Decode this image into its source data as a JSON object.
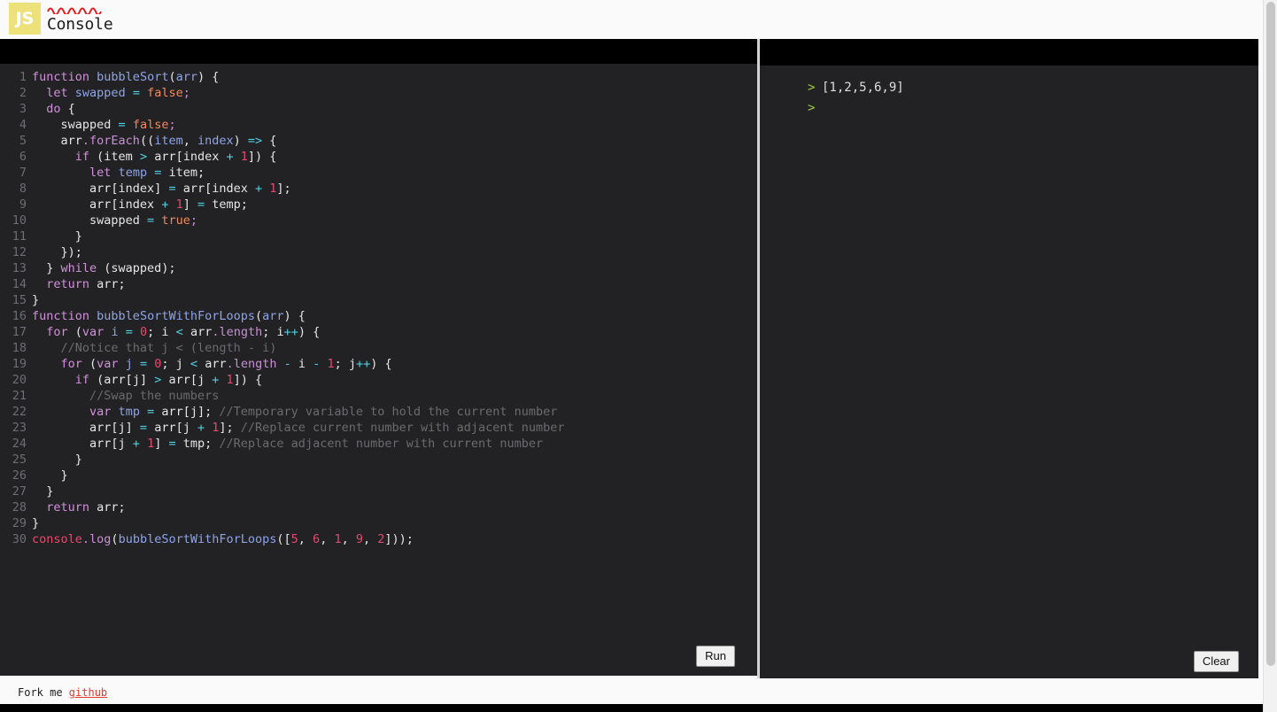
{
  "header": {
    "logo_text": "JS",
    "title": "Console",
    "squiggle_color": "#e02020",
    "logo_bg": "#ede17a"
  },
  "editor": {
    "run_label": "Run",
    "line_count": 30,
    "lines": [
      {
        "n": "1",
        "tokens": [
          {
            "t": "function",
            "c": "kw"
          },
          {
            "t": " ",
            "c": "plain"
          },
          {
            "t": "bubbleSort",
            "c": "fn"
          },
          {
            "t": "(",
            "c": "plain"
          },
          {
            "t": "arr",
            "c": "fn"
          },
          {
            "t": ") {",
            "c": "plain"
          }
        ]
      },
      {
        "n": "2",
        "tokens": [
          {
            "t": "  ",
            "c": "plain"
          },
          {
            "t": "let",
            "c": "kw"
          },
          {
            "t": " ",
            "c": "plain"
          },
          {
            "t": "swapped",
            "c": "fn"
          },
          {
            "t": " ",
            "c": "plain"
          },
          {
            "t": "=",
            "c": "op"
          },
          {
            "t": " ",
            "c": "plain"
          },
          {
            "t": "false",
            "c": "bool"
          },
          {
            "t": ";",
            "c": "punc"
          }
        ]
      },
      {
        "n": "3",
        "tokens": [
          {
            "t": "  ",
            "c": "plain"
          },
          {
            "t": "do",
            "c": "kw"
          },
          {
            "t": " {",
            "c": "plain"
          }
        ]
      },
      {
        "n": "4",
        "tokens": [
          {
            "t": "    swapped ",
            "c": "plain"
          },
          {
            "t": "=",
            "c": "op"
          },
          {
            "t": " ",
            "c": "plain"
          },
          {
            "t": "false",
            "c": "bool"
          },
          {
            "t": ";",
            "c": "punc"
          }
        ]
      },
      {
        "n": "5",
        "tokens": [
          {
            "t": "    arr",
            "c": "plain"
          },
          {
            "t": ".forEach",
            "c": "prop"
          },
          {
            "t": "((",
            "c": "plain"
          },
          {
            "t": "item",
            "c": "fn"
          },
          {
            "t": ", ",
            "c": "plain"
          },
          {
            "t": "index",
            "c": "fn"
          },
          {
            "t": ") ",
            "c": "plain"
          },
          {
            "t": "=>",
            "c": "op"
          },
          {
            "t": " {",
            "c": "plain"
          }
        ]
      },
      {
        "n": "6",
        "tokens": [
          {
            "t": "      ",
            "c": "plain"
          },
          {
            "t": "if",
            "c": "kw"
          },
          {
            "t": " (item ",
            "c": "plain"
          },
          {
            "t": ">",
            "c": "op"
          },
          {
            "t": " arr[index ",
            "c": "plain"
          },
          {
            "t": "+",
            "c": "op"
          },
          {
            "t": " ",
            "c": "plain"
          },
          {
            "t": "1",
            "c": "num"
          },
          {
            "t": "]) {",
            "c": "plain"
          }
        ]
      },
      {
        "n": "7",
        "tokens": [
          {
            "t": "        ",
            "c": "plain"
          },
          {
            "t": "let",
            "c": "kw"
          },
          {
            "t": " ",
            "c": "plain"
          },
          {
            "t": "temp",
            "c": "fn"
          },
          {
            "t": " ",
            "c": "plain"
          },
          {
            "t": "=",
            "c": "op"
          },
          {
            "t": " item;",
            "c": "plain"
          }
        ]
      },
      {
        "n": "8",
        "tokens": [
          {
            "t": "        arr[index] ",
            "c": "plain"
          },
          {
            "t": "=",
            "c": "op"
          },
          {
            "t": " arr[index ",
            "c": "plain"
          },
          {
            "t": "+",
            "c": "op"
          },
          {
            "t": " ",
            "c": "plain"
          },
          {
            "t": "1",
            "c": "num"
          },
          {
            "t": "];",
            "c": "plain"
          }
        ]
      },
      {
        "n": "9",
        "tokens": [
          {
            "t": "        arr[index ",
            "c": "plain"
          },
          {
            "t": "+",
            "c": "op"
          },
          {
            "t": " ",
            "c": "plain"
          },
          {
            "t": "1",
            "c": "num"
          },
          {
            "t": "] ",
            "c": "plain"
          },
          {
            "t": "=",
            "c": "op"
          },
          {
            "t": " temp;",
            "c": "plain"
          }
        ]
      },
      {
        "n": "10",
        "tokens": [
          {
            "t": "        swapped ",
            "c": "plain"
          },
          {
            "t": "=",
            "c": "op"
          },
          {
            "t": " ",
            "c": "plain"
          },
          {
            "t": "true",
            "c": "bool"
          },
          {
            "t": ";",
            "c": "punc"
          }
        ]
      },
      {
        "n": "11",
        "tokens": [
          {
            "t": "      }",
            "c": "plain"
          }
        ]
      },
      {
        "n": "12",
        "tokens": [
          {
            "t": "    });",
            "c": "plain"
          }
        ]
      },
      {
        "n": "13",
        "tokens": [
          {
            "t": "  } ",
            "c": "plain"
          },
          {
            "t": "while",
            "c": "kw"
          },
          {
            "t": " (swapped);",
            "c": "plain"
          }
        ]
      },
      {
        "n": "14",
        "tokens": [
          {
            "t": "  ",
            "c": "plain"
          },
          {
            "t": "return",
            "c": "kw"
          },
          {
            "t": " arr;",
            "c": "plain"
          }
        ]
      },
      {
        "n": "15",
        "tokens": [
          {
            "t": "}",
            "c": "plain"
          }
        ]
      },
      {
        "n": "16",
        "tokens": [
          {
            "t": "function",
            "c": "kw"
          },
          {
            "t": " ",
            "c": "plain"
          },
          {
            "t": "bubbleSortWithForLoops",
            "c": "fn"
          },
          {
            "t": "(",
            "c": "plain"
          },
          {
            "t": "arr",
            "c": "fn"
          },
          {
            "t": ") {",
            "c": "plain"
          }
        ]
      },
      {
        "n": "17",
        "tokens": [
          {
            "t": "  ",
            "c": "plain"
          },
          {
            "t": "for",
            "c": "kw"
          },
          {
            "t": " (",
            "c": "plain"
          },
          {
            "t": "var",
            "c": "kw"
          },
          {
            "t": " ",
            "c": "plain"
          },
          {
            "t": "i",
            "c": "fn"
          },
          {
            "t": " ",
            "c": "plain"
          },
          {
            "t": "=",
            "c": "op"
          },
          {
            "t": " ",
            "c": "plain"
          },
          {
            "t": "0",
            "c": "num"
          },
          {
            "t": "; i ",
            "c": "plain"
          },
          {
            "t": "<",
            "c": "op"
          },
          {
            "t": " arr",
            "c": "plain"
          },
          {
            "t": ".length",
            "c": "prop"
          },
          {
            "t": "; i",
            "c": "plain"
          },
          {
            "t": "++",
            "c": "op"
          },
          {
            "t": ") {",
            "c": "plain"
          }
        ]
      },
      {
        "n": "18",
        "tokens": [
          {
            "t": "    //Notice that j < (length - i)",
            "c": "cmt"
          }
        ]
      },
      {
        "n": "19",
        "tokens": [
          {
            "t": "    ",
            "c": "plain"
          },
          {
            "t": "for",
            "c": "kw"
          },
          {
            "t": " (",
            "c": "plain"
          },
          {
            "t": "var",
            "c": "kw"
          },
          {
            "t": " ",
            "c": "plain"
          },
          {
            "t": "j",
            "c": "fn"
          },
          {
            "t": " ",
            "c": "plain"
          },
          {
            "t": "=",
            "c": "op"
          },
          {
            "t": " ",
            "c": "plain"
          },
          {
            "t": "0",
            "c": "num"
          },
          {
            "t": "; j ",
            "c": "plain"
          },
          {
            "t": "<",
            "c": "op"
          },
          {
            "t": " arr",
            "c": "plain"
          },
          {
            "t": ".length",
            "c": "prop"
          },
          {
            "t": " ",
            "c": "plain"
          },
          {
            "t": "-",
            "c": "op"
          },
          {
            "t": " i ",
            "c": "plain"
          },
          {
            "t": "-",
            "c": "op"
          },
          {
            "t": " ",
            "c": "plain"
          },
          {
            "t": "1",
            "c": "num"
          },
          {
            "t": "; j",
            "c": "plain"
          },
          {
            "t": "++",
            "c": "op"
          },
          {
            "t": ") {",
            "c": "plain"
          }
        ]
      },
      {
        "n": "20",
        "tokens": [
          {
            "t": "      ",
            "c": "plain"
          },
          {
            "t": "if",
            "c": "kw"
          },
          {
            "t": " (arr[j] ",
            "c": "plain"
          },
          {
            "t": ">",
            "c": "op"
          },
          {
            "t": " arr[j ",
            "c": "plain"
          },
          {
            "t": "+",
            "c": "op"
          },
          {
            "t": " ",
            "c": "plain"
          },
          {
            "t": "1",
            "c": "num"
          },
          {
            "t": "]) {",
            "c": "plain"
          }
        ]
      },
      {
        "n": "21",
        "tokens": [
          {
            "t": "        //Swap the numbers",
            "c": "cmt"
          }
        ]
      },
      {
        "n": "22",
        "tokens": [
          {
            "t": "        ",
            "c": "plain"
          },
          {
            "t": "var",
            "c": "kw"
          },
          {
            "t": " ",
            "c": "plain"
          },
          {
            "t": "tmp",
            "c": "fn"
          },
          {
            "t": " ",
            "c": "plain"
          },
          {
            "t": "=",
            "c": "op"
          },
          {
            "t": " arr[j]; ",
            "c": "plain"
          },
          {
            "t": "//Temporary variable to hold the current number",
            "c": "cmt"
          }
        ]
      },
      {
        "n": "23",
        "tokens": [
          {
            "t": "        arr[j] ",
            "c": "plain"
          },
          {
            "t": "=",
            "c": "op"
          },
          {
            "t": " arr[j ",
            "c": "plain"
          },
          {
            "t": "+",
            "c": "op"
          },
          {
            "t": " ",
            "c": "plain"
          },
          {
            "t": "1",
            "c": "num"
          },
          {
            "t": "]; ",
            "c": "plain"
          },
          {
            "t": "//Replace current number with adjacent number",
            "c": "cmt"
          }
        ]
      },
      {
        "n": "24",
        "tokens": [
          {
            "t": "        arr[j ",
            "c": "plain"
          },
          {
            "t": "+",
            "c": "op"
          },
          {
            "t": " ",
            "c": "plain"
          },
          {
            "t": "1",
            "c": "num"
          },
          {
            "t": "] ",
            "c": "plain"
          },
          {
            "t": "=",
            "c": "op"
          },
          {
            "t": " tmp; ",
            "c": "plain"
          },
          {
            "t": "//Replace adjacent number with current number",
            "c": "cmt"
          }
        ]
      },
      {
        "n": "25",
        "tokens": [
          {
            "t": "      }",
            "c": "plain"
          }
        ]
      },
      {
        "n": "26",
        "tokens": [
          {
            "t": "    }",
            "c": "plain"
          }
        ]
      },
      {
        "n": "27",
        "tokens": [
          {
            "t": "  }",
            "c": "plain"
          }
        ]
      },
      {
        "n": "28",
        "tokens": [
          {
            "t": "  ",
            "c": "plain"
          },
          {
            "t": "return",
            "c": "kw"
          },
          {
            "t": " arr;",
            "c": "plain"
          }
        ]
      },
      {
        "n": "29",
        "tokens": [
          {
            "t": "}",
            "c": "plain"
          }
        ]
      },
      {
        "n": "30",
        "tokens": [
          {
            "t": "console",
            "c": "cons"
          },
          {
            "t": ".log",
            "c": "prop"
          },
          {
            "t": "(",
            "c": "plain"
          },
          {
            "t": "bubbleSortWithForLoops",
            "c": "fn"
          },
          {
            "t": "([",
            "c": "plain"
          },
          {
            "t": "5",
            "c": "num"
          },
          {
            "t": ", ",
            "c": "plain"
          },
          {
            "t": "6",
            "c": "num"
          },
          {
            "t": ", ",
            "c": "plain"
          },
          {
            "t": "1",
            "c": "num"
          },
          {
            "t": ", ",
            "c": "plain"
          },
          {
            "t": "9",
            "c": "num"
          },
          {
            "t": ", ",
            "c": "plain"
          },
          {
            "t": "2",
            "c": "num"
          },
          {
            "t": "]));",
            "c": "plain"
          }
        ]
      }
    ]
  },
  "console": {
    "clear_label": "Clear",
    "prompt_symbol": ">",
    "rows": [
      {
        "prompt": ">",
        "value": "[1,2,5,6,9]"
      },
      {
        "prompt": ">",
        "value": ""
      }
    ]
  },
  "footer": {
    "fork_text": "Fork me ",
    "github_label": "github"
  }
}
